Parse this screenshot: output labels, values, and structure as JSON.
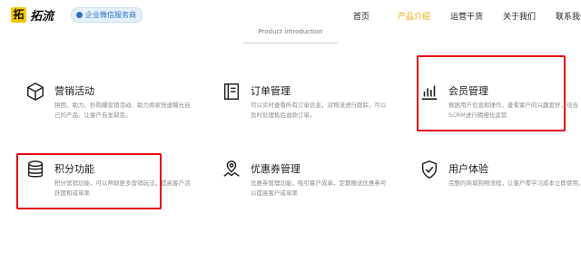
{
  "header": {
    "logo_mark": "拓",
    "logo_text": "拓流",
    "badge": "企业微信服务商",
    "nav": [
      "首页",
      "产品介绍",
      "运营干货",
      "关于我们",
      "联系我们"
    ],
    "nav_active_index": 1
  },
  "section": {
    "title": "Product introduction"
  },
  "features": [
    {
      "title": "营销活动",
      "desc": "拼团、助力、秒购爆营销活动、助力商家快速曝光自己的产品、让客户自发裂变。",
      "icon": "box-icon"
    },
    {
      "title": "订单管理",
      "desc": "可以实时查看所有订单信息，对物流进行跟踪，可以及时处理售后退款订单。",
      "icon": "book-icon"
    },
    {
      "title": "会员管理",
      "desc": "根据用户信息和操作，查看客户的兴趣爱好，结合SCRM进行精细化运营",
      "icon": "bar-chart-icon"
    },
    {
      "title": "积分功能",
      "desc": "积分营销功能，可以帮助更多营销玩法，提高客户活跃度和成单率",
      "icon": "coins-icon"
    },
    {
      "title": "优惠券管理",
      "desc": "优惠券管理功能，吸引客户成单，定期赠送优惠券可以提高客户成单率",
      "icon": "map-pin-icon"
    },
    {
      "title": "用户体验",
      "desc": "完整的商城购物流程，让客户零学习成本立即使用。",
      "icon": "shield-check-icon"
    }
  ],
  "colors": {
    "accent": "#f2a500",
    "highlight": "#e60012",
    "badge_blue": "#2d6fc6"
  }
}
